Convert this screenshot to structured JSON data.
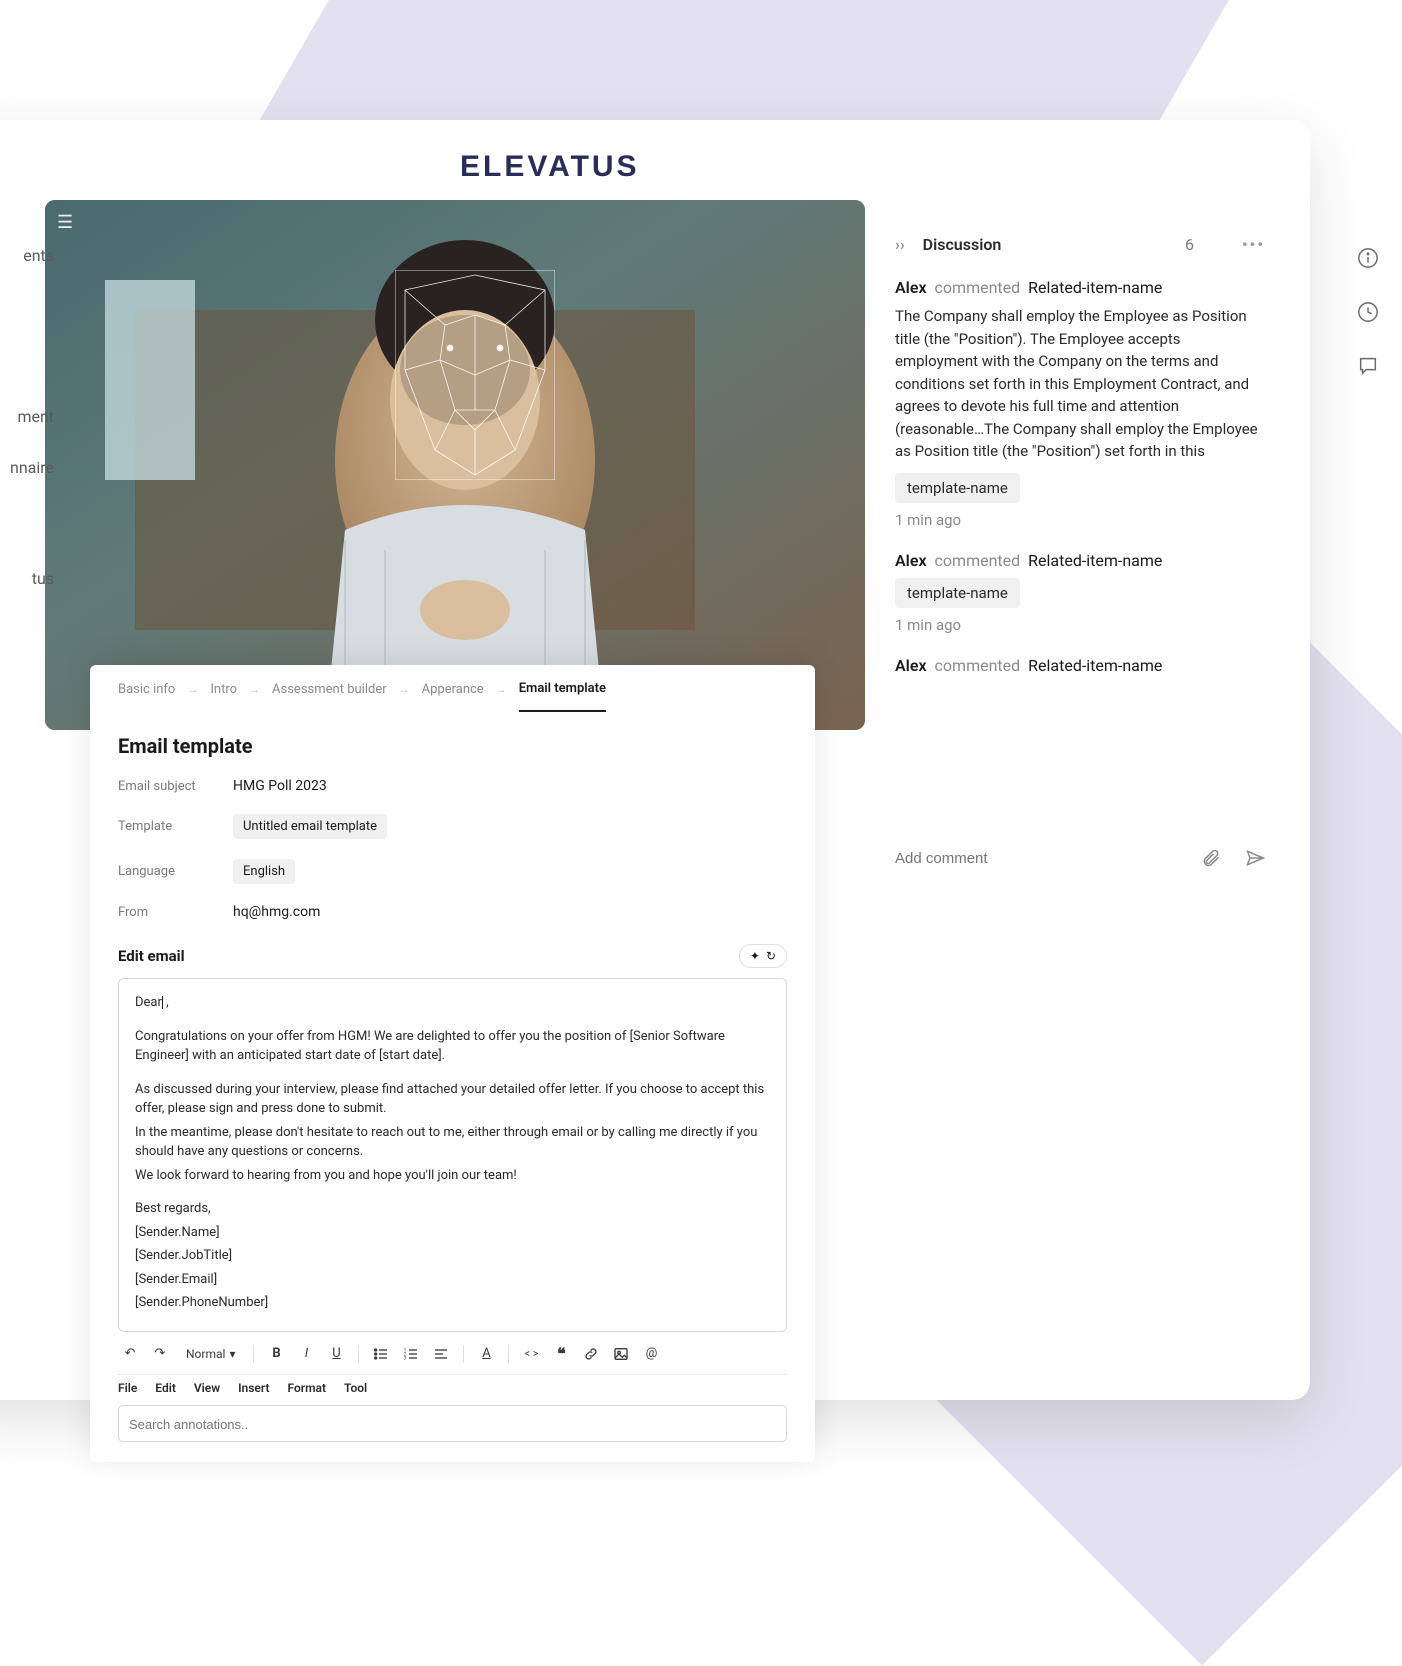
{
  "brand": "ELEVATUS",
  "leftNav": {
    "item0": "ents",
    "item1": "ment",
    "item2": "nnaire",
    "item3": "tus"
  },
  "discussion": {
    "title": "Discussion",
    "count": "6",
    "addPlaceholder": "Add comment",
    "comments": [
      {
        "author": "Alex",
        "action": "commented",
        "related": "Related-item-name",
        "body": "The Company shall employ the Employee as Position title (the \"Position\"). The Employee accepts employment with the Company on the terms and conditions set forth in this Employment Contract, and agrees to devote his full time and attention (reasonable…The Company shall employ the Employee as Position title (the \"Position\") set forth in this",
        "tag": "template-name",
        "ago": "1 min ago"
      },
      {
        "author": "Alex",
        "action": "commented",
        "related": "Related-item-name",
        "body": "",
        "tag": "template-name",
        "ago": "1 min ago"
      },
      {
        "author": "Alex",
        "action": "commented",
        "related": "Related-item-name",
        "body": "",
        "tag": "",
        "ago": ""
      }
    ]
  },
  "breadcrumb": {
    "step0": "Basic info",
    "step1": "Intro",
    "step2": "Assessment builder",
    "step3": "Apperance",
    "step4": "Email template"
  },
  "form": {
    "title": "Email template",
    "subjectLabel": "Email subject",
    "subjectValue": "HMG Poll 2023",
    "templateLabel": "Template",
    "templateValue": "Untitled email template",
    "languageLabel": "Language",
    "languageValue": "English",
    "fromLabel": "From",
    "fromValue": "hq@hmg.com",
    "editTitle": "Edit email"
  },
  "editor": {
    "greeting": "Dear",
    "p1": "Congratulations on your offer from HGM! We are delighted to offer you the position of [Senior Software Engineer] with an anticipated start date of [start date].",
    "p2a": "As discussed during your interview, please find attached your detailed offer letter. If you choose to accept this offer, please sign and press done to submit.",
    "p2b": "In the meantime, please don't hesitate to reach out to me, either through email or by calling me directly if you should have any questions or concerns.",
    "p2c": "We look forward to hearing from you and hope you'll join our team!",
    "s1": "Best regards,",
    "s2": "[Sender.Name]",
    "s3": "[Sender.JobTitle]",
    "s4": "[Sender.Email]",
    "s5": "[Sender.PhoneNumber]"
  },
  "toolbar": {
    "style": "Normal"
  },
  "menubar": {
    "m0": "File",
    "m1": "Edit",
    "m2": "View",
    "m3": "Insert",
    "m4": "Format",
    "m5": "Tool"
  },
  "search": {
    "placeholder": "Search annotations.."
  }
}
